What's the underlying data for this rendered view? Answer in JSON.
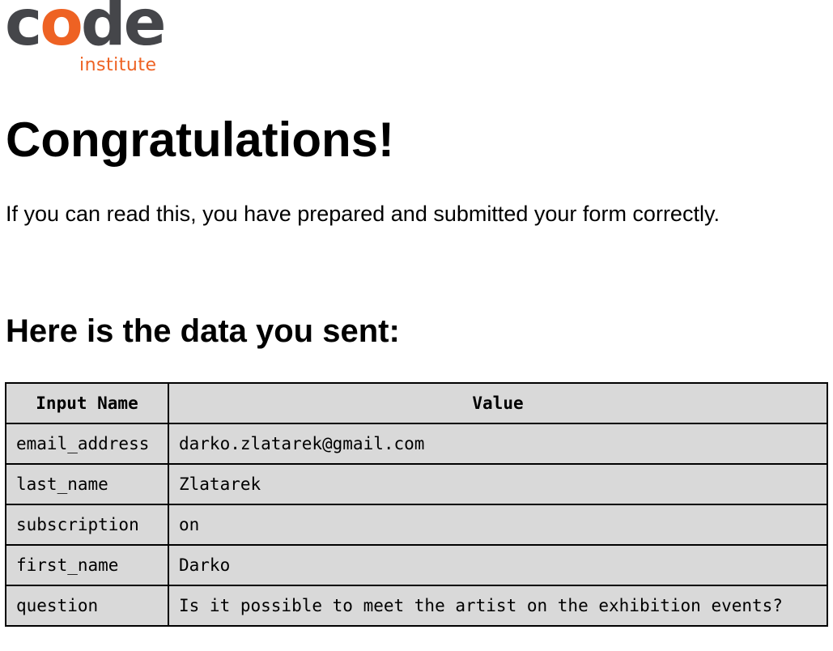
{
  "logo": {
    "word_prefix": "c",
    "word_accent": "o",
    "word_suffix": "de",
    "subtitle": "institute",
    "colors": {
      "dark": "#45464a",
      "accent": "#ee6223"
    }
  },
  "page": {
    "title": "Congratulations!",
    "intro": "If you can read this, you have prepared and submitted your form correctly.",
    "data_heading": "Here is the data you sent:"
  },
  "table": {
    "headers": [
      "Input Name",
      "Value"
    ],
    "rows": [
      [
        "email_address",
        "darko.zlatarek@gmail.com"
      ],
      [
        "last_name",
        "Zlatarek"
      ],
      [
        "subscription",
        "on"
      ],
      [
        "first_name",
        "Darko"
      ],
      [
        "question",
        "Is it possible to meet the artist on the exhibition events?"
      ]
    ],
    "colors": {
      "cell_bg": "#d9d9d9",
      "border": "#000000"
    }
  }
}
